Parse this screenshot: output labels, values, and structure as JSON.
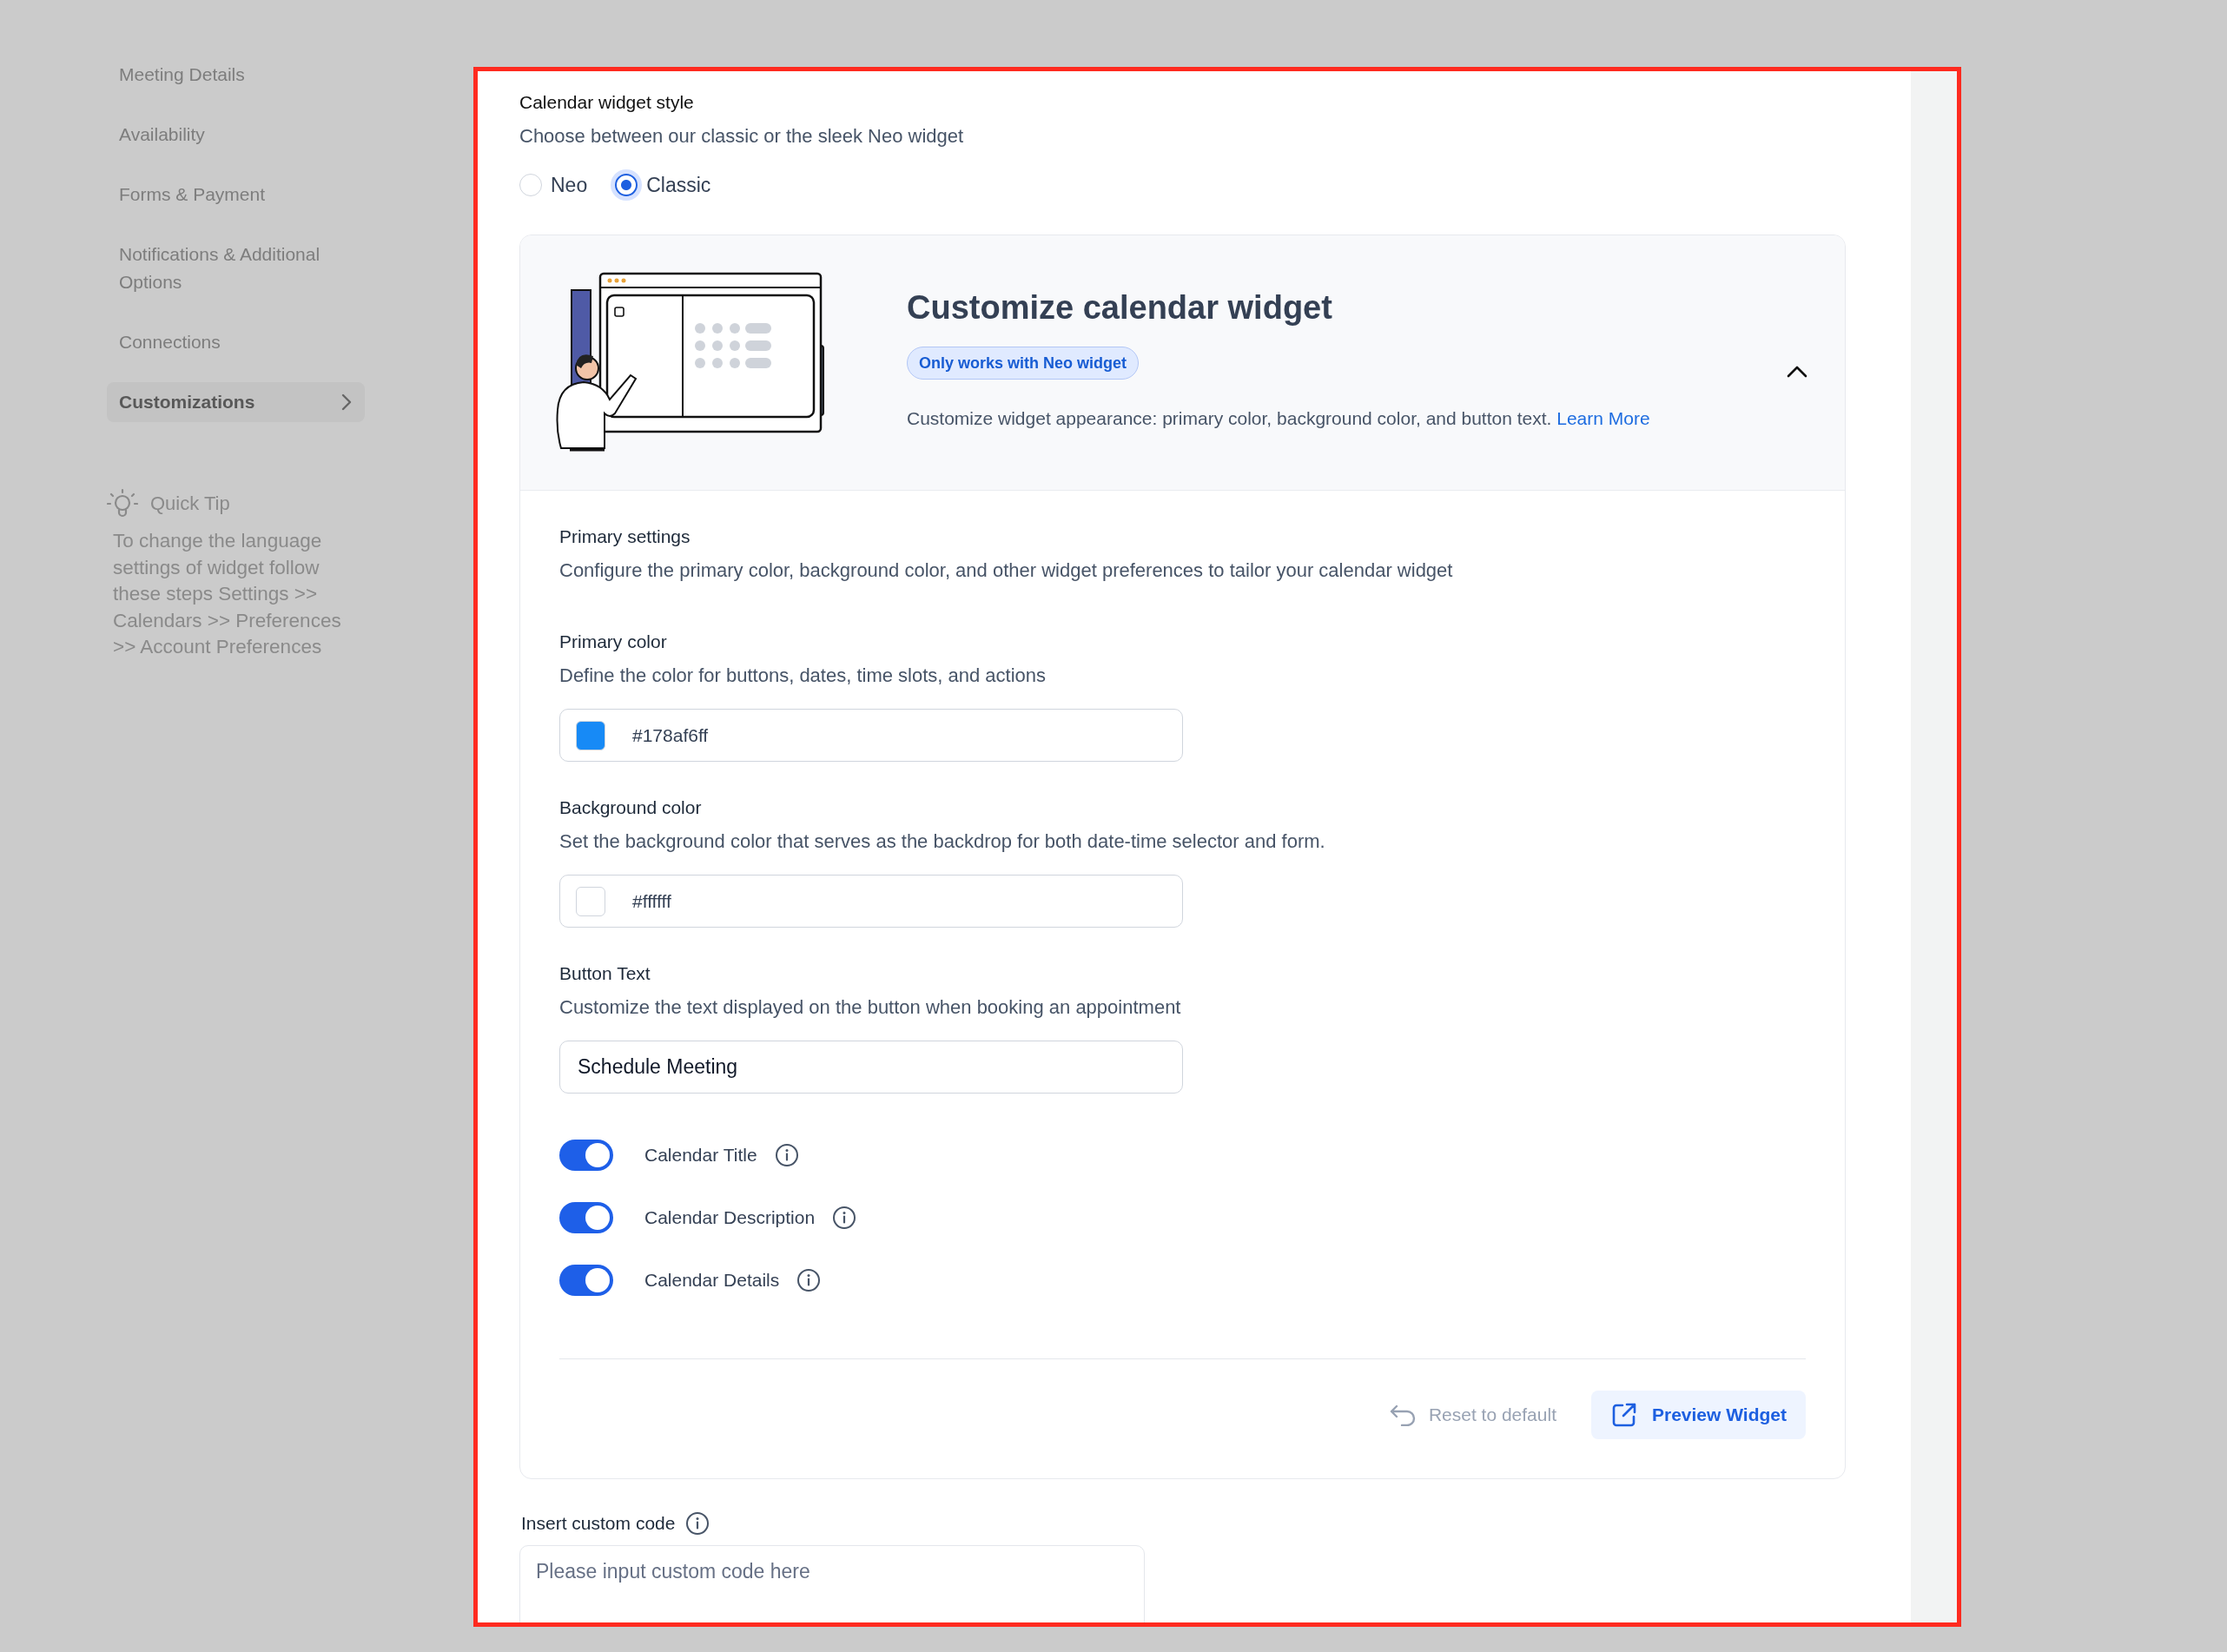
{
  "sidebar": {
    "items": [
      {
        "label": "Meeting Details",
        "selected": false
      },
      {
        "label": "Availability",
        "selected": false
      },
      {
        "label": "Forms & Payment",
        "selected": false
      },
      {
        "label": "Notifications & Additional Options",
        "selected": false
      },
      {
        "label": "Connections",
        "selected": false
      },
      {
        "label": "Customizations",
        "selected": true
      }
    ],
    "quick_tip": {
      "title": "Quick Tip",
      "text": "To change the language settings of widget follow these steps Settings >> Calendars >> Preferences >> Account Preferences"
    }
  },
  "widget_style": {
    "title": "Calendar widget style",
    "description": "Choose between our classic or the sleek Neo widget",
    "options": [
      {
        "label": "Neo",
        "selected": false
      },
      {
        "label": "Classic",
        "selected": true
      }
    ]
  },
  "customize_card": {
    "title": "Customize calendar widget",
    "badge": "Only works with Neo widget",
    "expanded": true,
    "description": "Customize widget appearance: primary color, background color, and button text.",
    "link": "Learn More"
  },
  "primary_settings": {
    "title": "Primary settings",
    "description": "Configure the primary color, background color, and other widget preferences to tailor your calendar widget"
  },
  "fields": [
    {
      "kind": "color",
      "label": "Primary color",
      "description": "Define the color for buttons, dates, time slots, and actions",
      "value": "#178af6ff",
      "color": "#178af6"
    },
    {
      "kind": "color",
      "label": "Background color",
      "description": "Set the background color that serves as the backdrop for both date-time selector and form.",
      "value": "#ffffff",
      "color": "#ffffff"
    },
    {
      "kind": "text",
      "label": "Button Text",
      "description": "Customize the text displayed on the button when booking an appointment",
      "value": "Schedule Meeting"
    }
  ],
  "toggles": [
    {
      "label": "Calendar Title",
      "on": true
    },
    {
      "label": "Calendar Description",
      "on": true
    },
    {
      "label": "Calendar Details",
      "on": true
    }
  ],
  "actions": {
    "reset": "Reset to default",
    "preview": "Preview Widget"
  },
  "custom_code": {
    "label": "Insert custom code",
    "placeholder": "Please input custom code here"
  }
}
